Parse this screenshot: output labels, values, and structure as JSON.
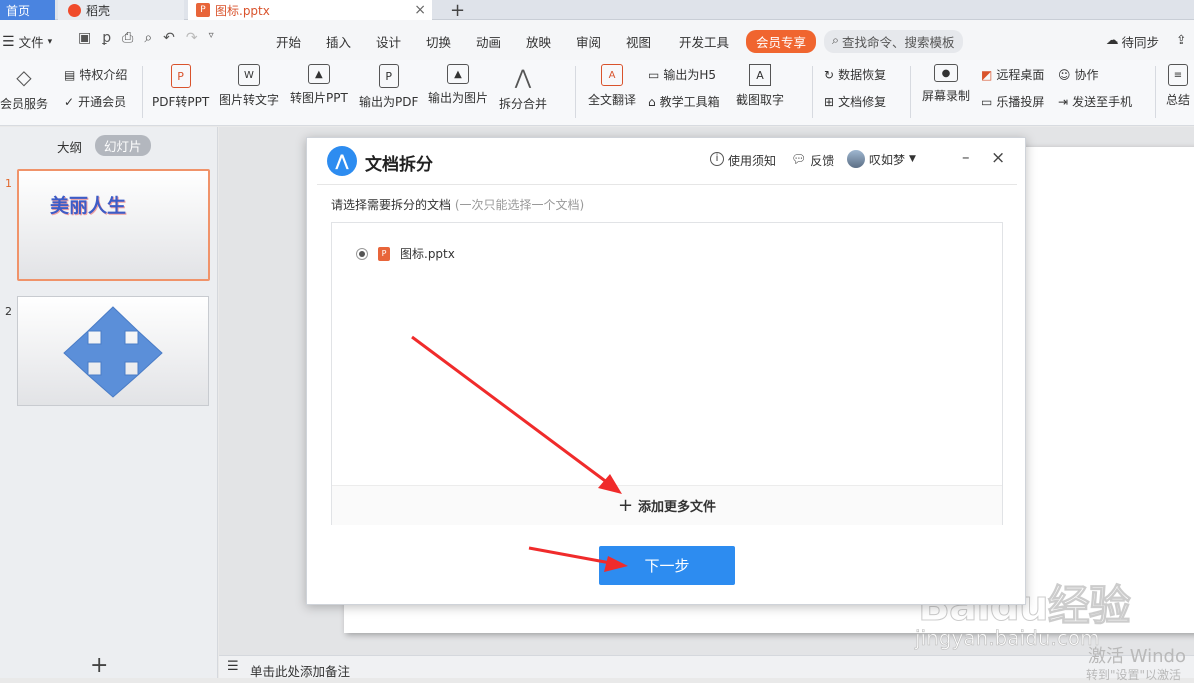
{
  "tabs": {
    "home": "首页",
    "daoke": "稻壳",
    "file": "图标.pptx"
  },
  "menu": {
    "file": "文件",
    "items": [
      "开始",
      "插入",
      "设计",
      "切换",
      "动画",
      "放映",
      "审阅",
      "视图",
      "开发工具"
    ],
    "member": "会员专享",
    "search_placeholder": "查找命令、搜索模板",
    "sync": "待同步"
  },
  "ribbon": {
    "member_service": "会员服务",
    "privilege": "特权介绍",
    "open_member": "开通会员",
    "pdf_to_ppt": "PDF转PPT",
    "img_to_text": "图片转文字",
    "to_img_ppt": "转图片PPT",
    "export_pdf": "输出为PDF",
    "export_img": "输出为图片",
    "split_merge": "拆分合并",
    "translate": "全文翻译",
    "export_h5": "输出为H5",
    "teach_tools": "教学工具箱",
    "screenshot_text": "截图取字",
    "data_recover": "数据恢复",
    "doc_repair": "文档修复",
    "screen_record": "屏幕录制",
    "remote_desktop": "远程桌面",
    "cast": "乐播投屏",
    "collab": "协作",
    "send_phone": "发送至手机",
    "summary": "总结"
  },
  "panel": {
    "outline": "大纲",
    "slides": "幻灯片",
    "slide1_num": "1",
    "slide1_title": "美丽人生",
    "slide2_num": "2",
    "add": "+"
  },
  "notes": {
    "placeholder": "单击此处添加备注"
  },
  "dialog": {
    "title": "文档拆分",
    "help": "使用须知",
    "feedback": "反馈",
    "user": "叹如梦",
    "instruction": "请选择需要拆分的文档",
    "instruction_hint": "(一次只能选择一个文档)",
    "file_name": "图标.pptx",
    "add_more": "添加更多文件",
    "next": "下一步"
  },
  "watermark": {
    "brand": "Baidu经验",
    "url": "jingyan.baidu.com",
    "activate1": "激活 Windo",
    "activate2": "转到\"设置\"以激活"
  },
  "colors": {
    "accent": "#2d8cf0",
    "member": "#f0652f",
    "arrow": "#f02b2b"
  }
}
